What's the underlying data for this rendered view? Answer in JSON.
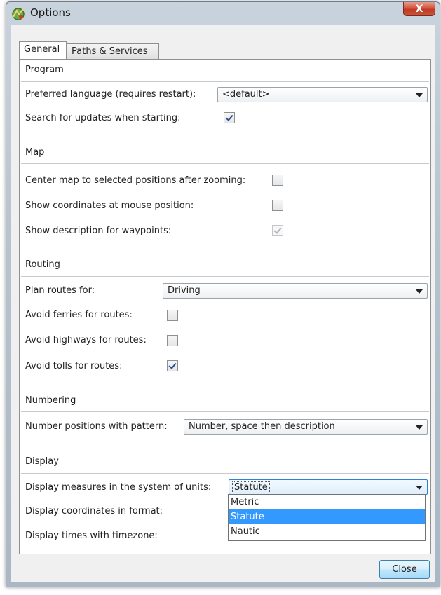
{
  "window": {
    "title": "Options",
    "close_glyph": "X"
  },
  "tabs": [
    {
      "label": "General",
      "active": true
    },
    {
      "label": "Paths & Services",
      "active": false
    }
  ],
  "sections": {
    "program": {
      "title": "Program",
      "preferred_language_label": "Preferred language (requires restart):",
      "preferred_language_value": "<default>",
      "search_updates_label": "Search for updates when starting:",
      "search_updates_checked": true
    },
    "map": {
      "title": "Map",
      "center_map_label": "Center map to selected positions after zooming:",
      "center_map_checked": false,
      "show_coords_label": "Show coordinates at mouse position:",
      "show_coords_checked": false,
      "show_desc_label": "Show description for waypoints:",
      "show_desc_checked": true
    },
    "routing": {
      "title": "Routing",
      "plan_routes_label": "Plan routes for:",
      "plan_routes_value": "Driving",
      "avoid_ferries_label": "Avoid ferries for routes:",
      "avoid_ferries_checked": false,
      "avoid_highways_label": "Avoid highways for routes:",
      "avoid_highways_checked": false,
      "avoid_tolls_label": "Avoid tolls for routes:",
      "avoid_tolls_checked": true
    },
    "numbering": {
      "title": "Numbering",
      "pattern_label": "Number positions with pattern:",
      "pattern_value": "Number, space then description"
    },
    "display": {
      "title": "Display",
      "units_label": "Display measures in the system of units:",
      "units_value": "Statute",
      "units_options": [
        "Metric",
        "Statute",
        "Nautic"
      ],
      "units_selected": "Statute",
      "coords_format_label": "Display coordinates in format:",
      "timezone_label": "Display times with timezone:"
    }
  },
  "buttons": {
    "close_label": "Close"
  },
  "colors": {
    "selection": "#3399ff",
    "close_button_border": "#3c7fb1",
    "titlebar_close": "#c13b22"
  },
  "icons": {
    "app": "compass-map-icon",
    "dropdown": "chevron-down-icon",
    "check": "checkmark-icon"
  }
}
